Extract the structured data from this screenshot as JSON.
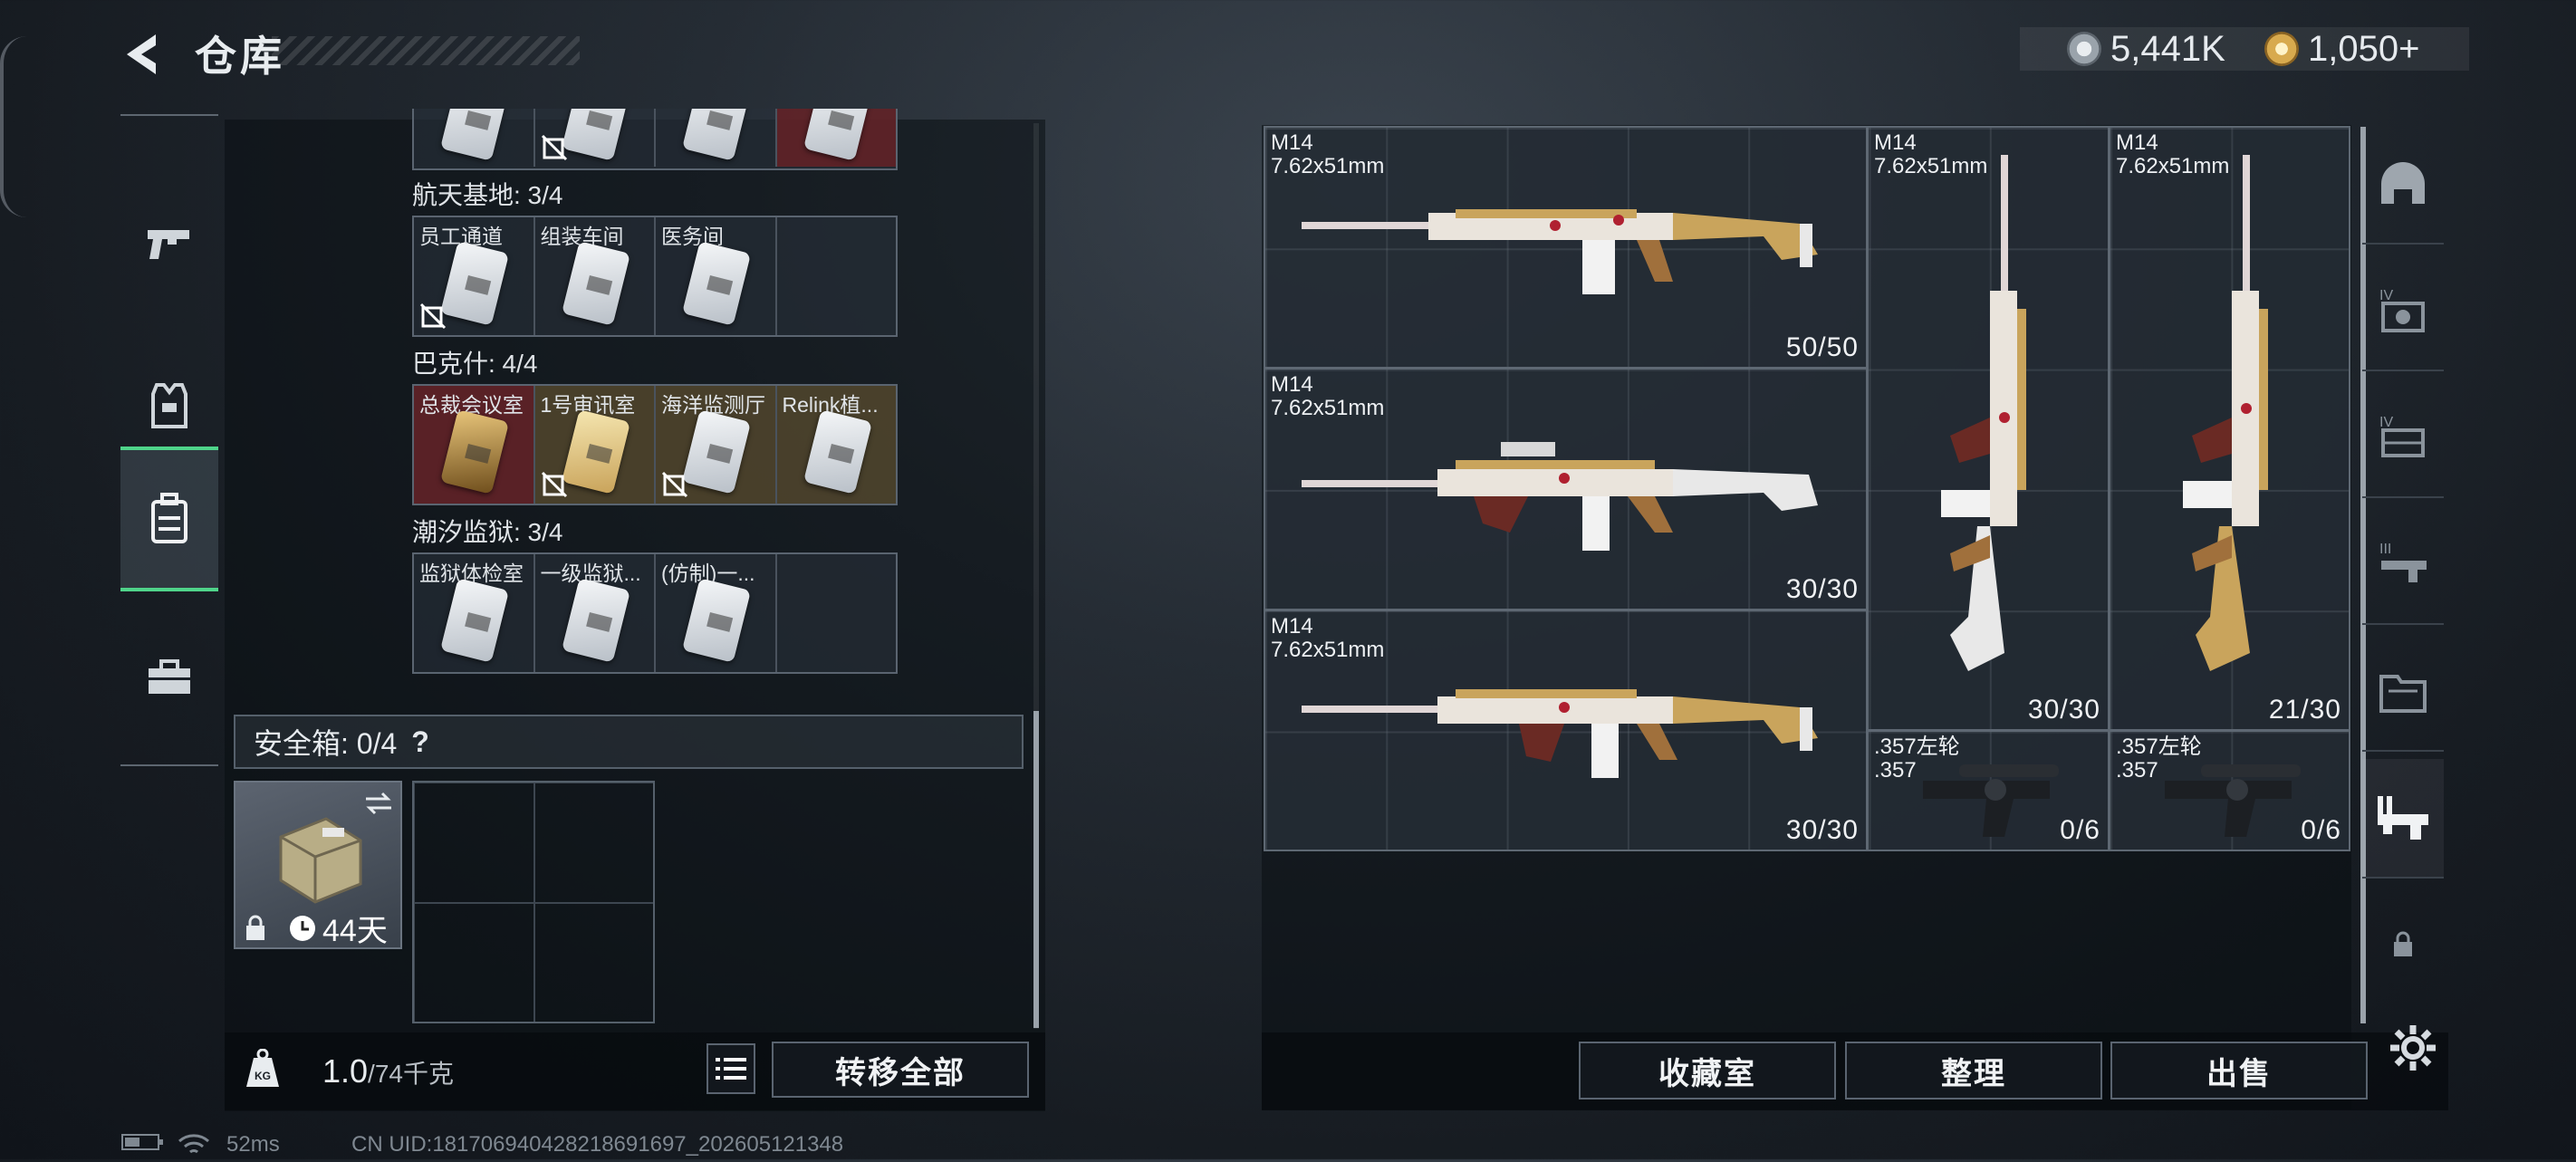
{
  "header": {
    "title": "仓库",
    "silver": "5,441K",
    "gold": "1,050+"
  },
  "nav": {
    "items": [
      {
        "name": "weapons",
        "icon": "pistol-icon",
        "active": false
      },
      {
        "name": "armor",
        "icon": "vest-icon",
        "active": false
      },
      {
        "name": "backpack",
        "icon": "backpack-icon",
        "active": true
      },
      {
        "name": "supplies",
        "icon": "toolbox-icon",
        "active": false
      }
    ]
  },
  "groups": [
    {
      "title": "航天基地: 3/4",
      "cards": [
        "员工通道",
        "组装车间",
        "医务间",
        ""
      ]
    },
    {
      "title": "巴克什: 4/4",
      "cards": [
        "总裁会议室",
        "1号审讯室",
        "海洋监测厅",
        "Relink植..."
      ]
    },
    {
      "title": "潮汐监狱: 3/4",
      "cards": [
        "监狱体检室",
        "一级监狱...",
        "(仿制)一...",
        ""
      ]
    }
  ],
  "safe": {
    "label": "安全箱: 0/4",
    "help": "?",
    "days": "44天"
  },
  "footer": {
    "weight": "1.0",
    "weight_max": "/74千克",
    "transfer_all": "转移全部",
    "collection": "收藏室",
    "sort": "整理",
    "sell": "出售"
  },
  "status": {
    "ping": "52ms",
    "uid": "CN UID:18170694042821869​1697_202605121348"
  },
  "weapons": [
    {
      "name": "M14",
      "caliber": "7.62x51mm",
      "ammo": "50/50"
    },
    {
      "name": "M14",
      "caliber": "7.62x51mm",
      "ammo": "30/30"
    },
    {
      "name": "M14",
      "caliber": "7.62x51mm",
      "ammo": "30/30"
    },
    {
      "name": "M14",
      "caliber": "7.62x51mm",
      "ammo": "30/30"
    },
    {
      "name": "M14",
      "caliber": "7.62x51mm",
      "ammo": "21/30"
    },
    {
      "name": ".357左轮",
      ".caliber": ".357",
      "caliber": ".357",
      "ammo": "0/6"
    },
    {
      "name": ".357左轮",
      "caliber": ".357",
      "ammo": "0/6"
    }
  ],
  "right_tabs": [
    "helmet-icon",
    "iv-armor-icon",
    "iv-rig-icon",
    "iii-gun-icon",
    "folder-icon",
    "gun-rack-icon",
    "lock-icon"
  ]
}
